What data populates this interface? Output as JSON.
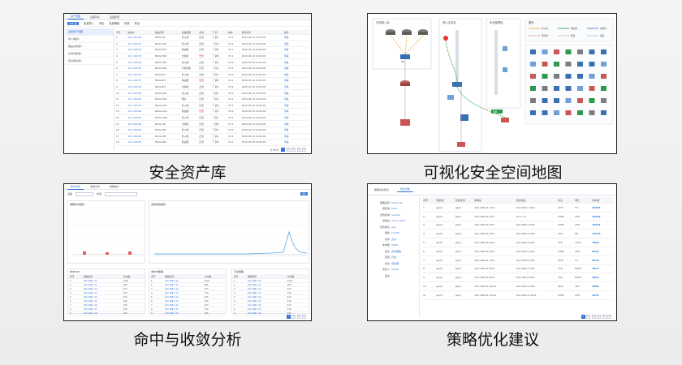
{
  "captions": [
    "安全资产库",
    "可视化安全空间地图",
    "命中与收敛分析",
    "策略优化建议"
  ],
  "colors": {
    "accent": "#2f6fd6",
    "link": "#2a6fd6",
    "danger": "#d33333",
    "border": "#1f1f1f"
  },
  "panel1": {
    "tabs": [
      "资产视图",
      "设备列表",
      "设备配置"
    ],
    "toolbar": [
      "新增设备",
      "批量导入",
      "导出",
      "批量删除",
      "修改",
      "导出"
    ],
    "side_items": [
      "全部资产视图",
      "防火墙组1",
      "路由交换组1",
      "负载均衡组1",
      "安全网关组1"
    ],
    "headers": [
      "序号",
      "设备IP",
      "设备名称",
      "设备类型",
      "状态",
      "厂商",
      "版本",
      "更新时间",
      "操作"
    ],
    "rows": [
      [
        "1",
        "10.1.100.50",
        "NSAS-FW",
        "防火墙",
        "正常",
        "厂商A",
        "V3.2",
        "2020-03-10 10:00:00",
        "查看"
      ],
      [
        "2",
        "10.1.100.51",
        "NSAS-FW2",
        "防火墙",
        "正常",
        "厂商A",
        "V3.2",
        "2020-03-10 10:00:00",
        "查看"
      ],
      [
        "3",
        "10.1.100.52",
        "NSAS-FW3",
        "路由器",
        "正常",
        "厂商B",
        "V5.1",
        "2020-03-10 10:00:00",
        "查看"
      ],
      [
        "4",
        "10.1.100.53",
        "NSAS-FW4",
        "交换机",
        "告警",
        "厂商B",
        "V5.1",
        "2020-03-10 10:00:00",
        "查看"
      ],
      [
        "5",
        "10.1.100.54",
        "NSAS-FW5",
        "防火墙",
        "正常",
        "厂商C",
        "V2.0",
        "2020-03-10 10:00:00",
        "查看"
      ],
      [
        "6",
        "10.1.100.55",
        "NSAS-FW6",
        "负载均衡",
        "正常",
        "厂商A",
        "V3.2",
        "2020-03-10 10:00:00",
        "查看"
      ],
      [
        "7",
        "10.1.100.56",
        "NSAS-RT1",
        "防火墙",
        "正常",
        "厂商C",
        "V2.0",
        "2020-03-10 10:00:00",
        "查看"
      ],
      [
        "8",
        "10.1.100.57",
        "NSAS-RT2",
        "路由器",
        "告警",
        "厂商B",
        "V5.1",
        "2020-03-10 10:00:00",
        "查看"
      ],
      [
        "9",
        "10.1.100.58",
        "NSAS-RT3",
        "交换机",
        "正常",
        "厂商A",
        "V3.2",
        "2020-03-10 10:00:00",
        "查看"
      ],
      [
        "10",
        "10.1.100.59",
        "NSAS-SW1",
        "防火墙",
        "正常",
        "厂商C",
        "V2.0",
        "2020-03-10 10:00:00",
        "查看"
      ],
      [
        "11",
        "10.1.100.60",
        "NSAS-SW2",
        "网关",
        "正常",
        "厂商A",
        "V3.2",
        "2020-03-10 10:00:00",
        "查看"
      ],
      [
        "12",
        "10.1.100.61",
        "NSAS-SW3",
        "防火墙",
        "正常",
        "厂商B",
        "V5.1",
        "2020-03-10 10:00:00",
        "查看"
      ],
      [
        "13",
        "10.1.100.62",
        "NSAS-GW1",
        "路由器",
        "告警",
        "厂商C",
        "V2.0",
        "2020-03-10 10:00:00",
        "查看"
      ],
      [
        "14",
        "10.1.100.63",
        "NSAS-GW2",
        "防火墙",
        "正常",
        "厂商A",
        "V3.2",
        "2020-03-10 10:00:00",
        "查看"
      ],
      [
        "15",
        "10.1.100.64",
        "NSAS-LB1",
        "交换机",
        "正常",
        "厂商B",
        "V5.1",
        "2020-03-10 10:00:00",
        "查看"
      ],
      [
        "16",
        "10.1.100.65",
        "NSAS-LB2",
        "防火墙",
        "正常",
        "厂商C",
        "V2.0",
        "2020-03-10 10:00:00",
        "查看"
      ],
      [
        "17",
        "10.1.100.66",
        "NSAS-LB3",
        "防火墙",
        "正常",
        "厂商A",
        "V3.2",
        "2020-03-10 10:00:00",
        "查看"
      ],
      [
        "18",
        "10.1.100.67",
        "NSAS-DB1",
        "路由器",
        "正常",
        "厂商B",
        "V5.1",
        "2020-03-10 10:00:00",
        "查看"
      ]
    ],
    "pager": [
      "1",
      "2",
      "3",
      "4",
      "5"
    ],
    "total": "共 88 条"
  },
  "panel2": {
    "zone_labels": [
      "外部接入区",
      "核心业务区",
      "安全管理区"
    ],
    "legend_title": "图例",
    "legend_items": [
      "防火墙",
      "路由器",
      "交换机",
      "服务器",
      "终端",
      "链路"
    ],
    "link_label": "策略"
  },
  "panel3": {
    "tabs": [
      "命中分析",
      "收敛分析",
      "策略统计"
    ],
    "filters": [
      "设备",
      "时间"
    ],
    "query_label": "查询",
    "chart_titles": [
      "策略命中趋势",
      "流量收敛趋势"
    ],
    "table_titles": [
      "命中TOP",
      "未命中策略",
      "冗余策略"
    ],
    "headers": [
      "序号",
      "策略名称",
      "命中数"
    ],
    "rows": [
      [
        "1",
        "192.168.1.10",
        "1024"
      ],
      [
        "2",
        "192.168.1.11",
        "980"
      ],
      [
        "3",
        "192.168.1.12",
        "873"
      ],
      [
        "4",
        "192.168.1.13",
        "720"
      ],
      [
        "5",
        "192.168.1.14",
        "615"
      ],
      [
        "6",
        "192.168.1.15",
        "540"
      ],
      [
        "7",
        "192.168.1.16",
        "433"
      ],
      [
        "8",
        "192.168.1.17",
        "310"
      ],
      [
        "9",
        "192.168.1.18",
        "205"
      ]
    ],
    "pager": [
      "1",
      "2",
      "3",
      "4"
    ]
  },
  "panel4": {
    "tabs": [
      "策略优化建议",
      "优化详情"
    ],
    "left_items": [
      [
        "策略名称",
        "policy-01"
      ],
      [
        "源区域",
        "trust"
      ],
      [
        "目的区域",
        "untrust"
      ],
      [
        "源地址",
        "10.1.1.0/24"
      ],
      [
        "目的地址",
        "any"
      ],
      [
        "服务",
        "tcp-80"
      ],
      [
        "动作",
        "允许"
      ],
      [
        "命中数",
        "2048"
      ],
      [
        "建议",
        "合并策略"
      ],
      [
        "原因",
        "冗余"
      ],
      [
        "状态",
        "待处理"
      ],
      [
        "责任人",
        "admin"
      ],
      [
        "备注",
        "-"
      ]
    ],
    "headers": [
      "序号",
      "源区域",
      "目的区域",
      "源地址",
      "目的地址",
      "协议",
      "端口",
      "命中数"
    ],
    "rows": [
      [
        "1",
        "gei/0",
        "gei/1",
        "192.168.10.1/24",
        "192.168.1.0/24",
        "UDP",
        "53",
        "24655"
      ],
      [
        "2",
        "gei/0",
        "gei/1",
        "192.168.10.2/24",
        "10.1.1.1",
        "ICMP",
        "ANY",
        "18462"
      ],
      [
        "3",
        "gei/0",
        "gei/1",
        "192.168.10.3/24",
        "192.168.2.0/24",
        "ICMP",
        "ANY",
        "16521"
      ],
      [
        "4",
        "gei/0",
        "gei/1",
        "192.168.10.4/24",
        "192.168.3.0/24",
        "TCP",
        "80",
        "11674"
      ],
      [
        "5",
        "gei/0",
        "gei/1",
        "192.168.10.5/24",
        "192.168.4.0/24",
        "TCP",
        "1234",
        "7856"
      ],
      [
        "6",
        "gei/0",
        "gei/1",
        "192.168.10.6/24",
        "192.168.5.0/24",
        "ICMP",
        "ANY",
        "6024"
      ],
      [
        "7",
        "gei/0",
        "gei/1",
        "192.168.10.7/24",
        "192.168.6.0/24",
        "UDP",
        "53",
        "4970"
      ],
      [
        "8",
        "gei/0",
        "gei/1",
        "192.168.10.8/24",
        "192.168.7.0/24",
        "TCP",
        "8080",
        "4017"
      ],
      [
        "9",
        "gei/0",
        "gei/1",
        "192.168.10.9/24",
        "192.168.8.0/24",
        "TCP",
        "8443",
        "3802"
      ],
      [
        "10",
        "gei/0",
        "gei/1",
        "192.168.10.10/24",
        "192.168.9.0/24",
        "UDP",
        "161",
        "2680"
      ],
      [
        "11",
        "gei/0",
        "gei/1",
        "192.168.10.11/24",
        "192.168.11.0/24",
        "ICMP",
        "ANY",
        "1975"
      ]
    ],
    "pager": [
      "1",
      "2",
      "3",
      "4",
      "5",
      "6"
    ]
  }
}
